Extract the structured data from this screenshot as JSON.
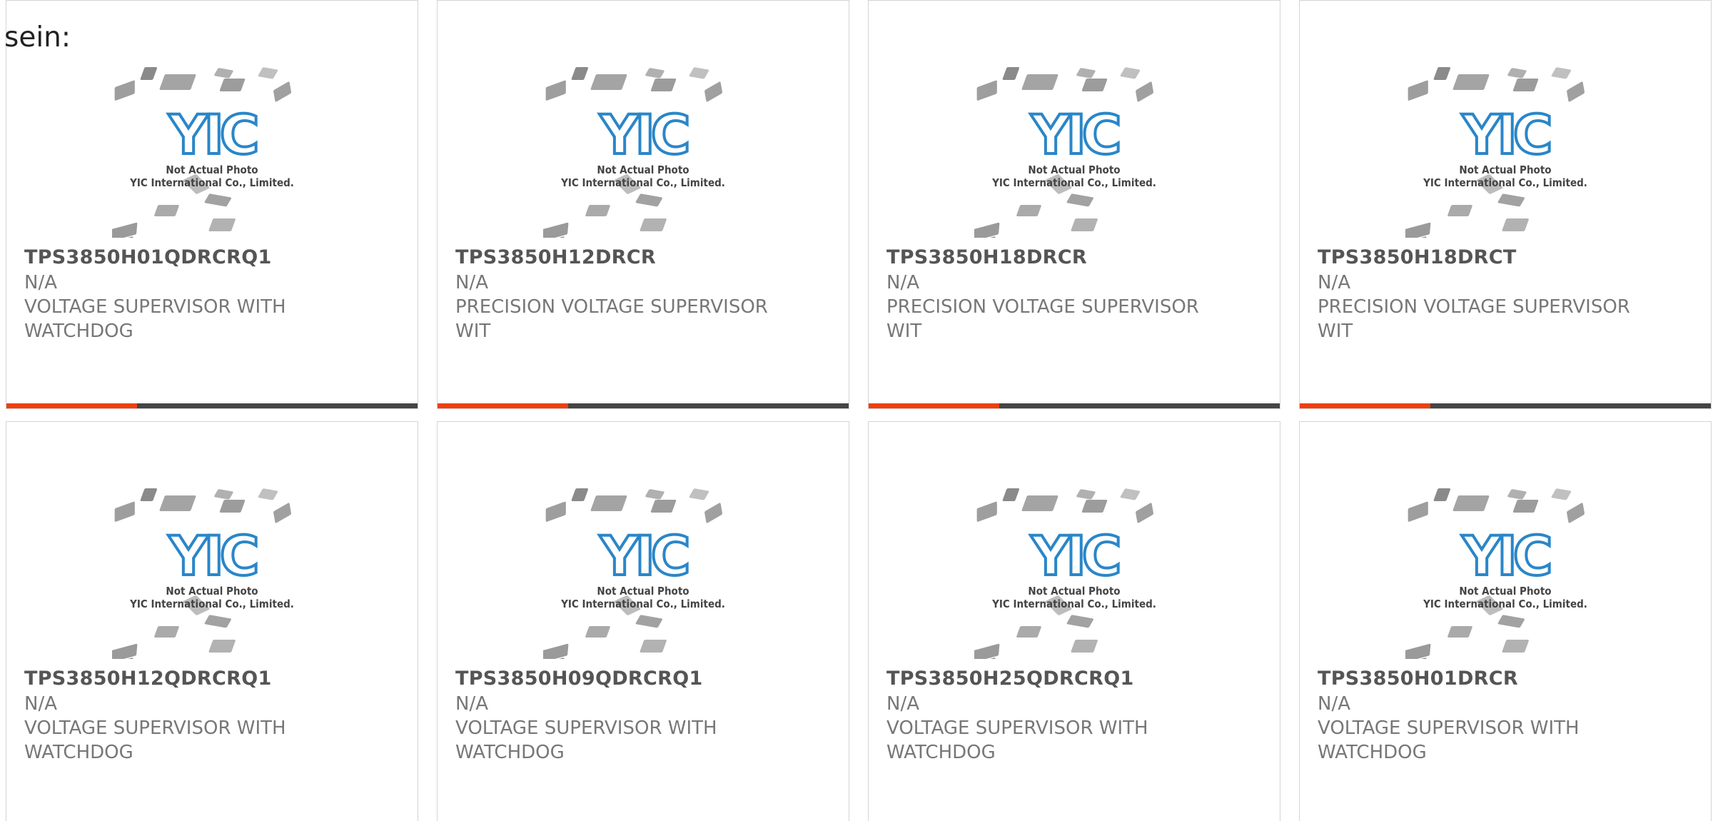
{
  "intro_text": "sein:",
  "photo": {
    "logo_text": "YIC",
    "caption_line1": "Not Actual Photo",
    "caption_line2": "YIC International Co., Limited.",
    "logo_color": "#2a86c8"
  },
  "colors": {
    "accent": "#ee4010",
    "bar": "#454545",
    "part_text": "#555555",
    "meta_text": "#777777"
  },
  "products": [
    {
      "part": "TPS3850H01QDRCRQ1",
      "manufacturer": "N/A",
      "description": "VOLTAGE SUPERVISOR WITH WATCHDOG",
      "show_bar": true
    },
    {
      "part": "TPS3850H12DRCR",
      "manufacturer": "N/A",
      "description": "PRECISION VOLTAGE SUPERVISOR WIT",
      "show_bar": true
    },
    {
      "part": "TPS3850H18DRCR",
      "manufacturer": "N/A",
      "description": "PRECISION VOLTAGE SUPERVISOR WIT",
      "show_bar": true
    },
    {
      "part": "TPS3850H18DRCT",
      "manufacturer": "N/A",
      "description": "PRECISION VOLTAGE SUPERVISOR WIT",
      "show_bar": true
    },
    {
      "part": "TPS3850H12QDRCRQ1",
      "manufacturer": "N/A",
      "description": "VOLTAGE SUPERVISOR WITH WATCHDOG",
      "show_bar": false
    },
    {
      "part": "TPS3850H09QDRCRQ1",
      "manufacturer": "N/A",
      "description": "VOLTAGE SUPERVISOR WITH WATCHDOG",
      "show_bar": false
    },
    {
      "part": "TPS3850H25QDRCRQ1",
      "manufacturer": "N/A",
      "description": "VOLTAGE SUPERVISOR WITH WATCHDOG",
      "show_bar": false
    },
    {
      "part": "TPS3850H01DRCR",
      "manufacturer": "N/A",
      "description": "VOLTAGE SUPERVISOR WITH WATCHDOG",
      "show_bar": false
    }
  ]
}
